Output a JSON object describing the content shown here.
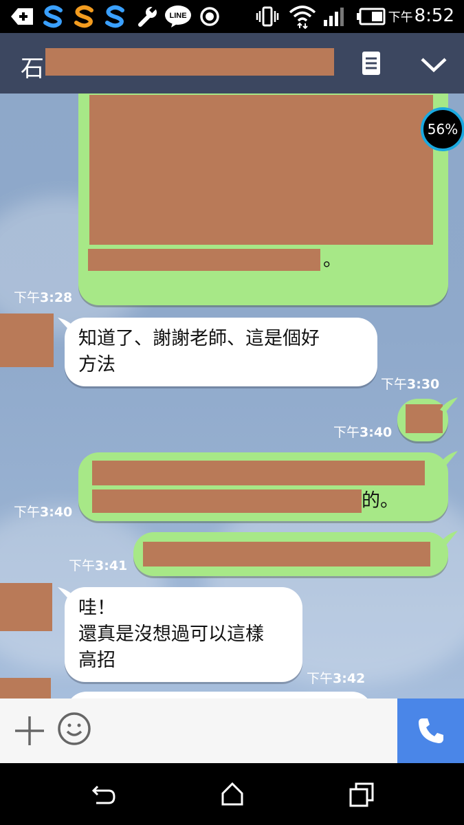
{
  "status_bar": {
    "time_ampm": "下午",
    "time": "8:52",
    "line_label": "LINE",
    "icons": [
      "add-icon",
      "s-app-blue-icon",
      "s-app-orange-icon",
      "s-app-blue-icon",
      "wrench-icon",
      "line-icon",
      "record-icon",
      "vibrate-icon",
      "wifi-icon",
      "signal-icon",
      "battery-icon"
    ]
  },
  "header": {
    "title_initial": "石",
    "menu_icon": "list-icon",
    "collapse_icon": "chevron-down-icon"
  },
  "overlay_badge": {
    "text": "56%"
  },
  "messages": [
    {
      "side": "me",
      "time": "下午3:28",
      "tail_text": "。"
    },
    {
      "side": "peer",
      "time": "下午3:30",
      "text": "知道了、謝謝老師、這是個好\n方法"
    },
    {
      "side": "me",
      "time": "下午3:40"
    },
    {
      "side": "me",
      "time": "下午3:40",
      "tail_text": "的。"
    },
    {
      "side": "me",
      "time": "下午3:41"
    },
    {
      "side": "peer",
      "time": "下午3:42",
      "text": "哇！\n還真是沒想過可以這樣\n高招"
    }
  ],
  "input_bar": {
    "plus_icon": "plus-icon",
    "emoji_icon": "emoji-icon",
    "call_icon": "phone-icon"
  },
  "nav_bar": {
    "icons": [
      "back-icon",
      "home-icon",
      "recents-icon"
    ]
  },
  "colors": {
    "header": "#3c4760",
    "my_bubble": "#a7e887",
    "peer_bubble": "#ffffff",
    "redaction": "#b97a58",
    "call": "#4a86e8"
  }
}
